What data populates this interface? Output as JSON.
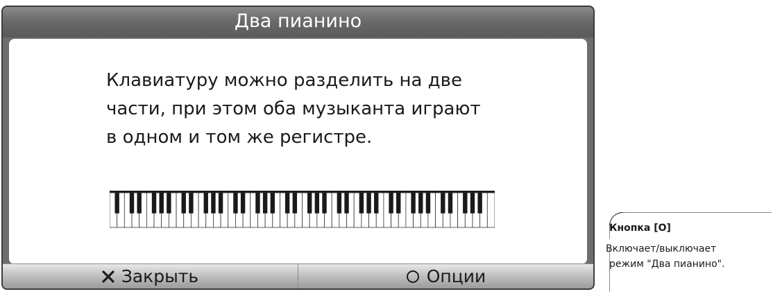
{
  "dialog": {
    "title": "Два пианино",
    "message_lines": [
      "Клавиатуру можно разделить на две",
      "части, при этом оба музыканта играют",
      "в одном и том же регистре."
    ],
    "keyboard": {
      "white_key_count": 52
    },
    "buttons": {
      "close_label": "Закрыть",
      "close_icon": "close-x-icon",
      "options_label": "Опции",
      "options_icon": "circle-o-icon"
    },
    "colors": {
      "title_bar": "#6a6a6a",
      "content_bg": "#ffffff",
      "footer": "#bdbdbd"
    }
  },
  "callout": {
    "title": "Кнопка [O]",
    "lines": [
      "Включает/выключает",
      "режим \"Два пианино\"."
    ]
  }
}
